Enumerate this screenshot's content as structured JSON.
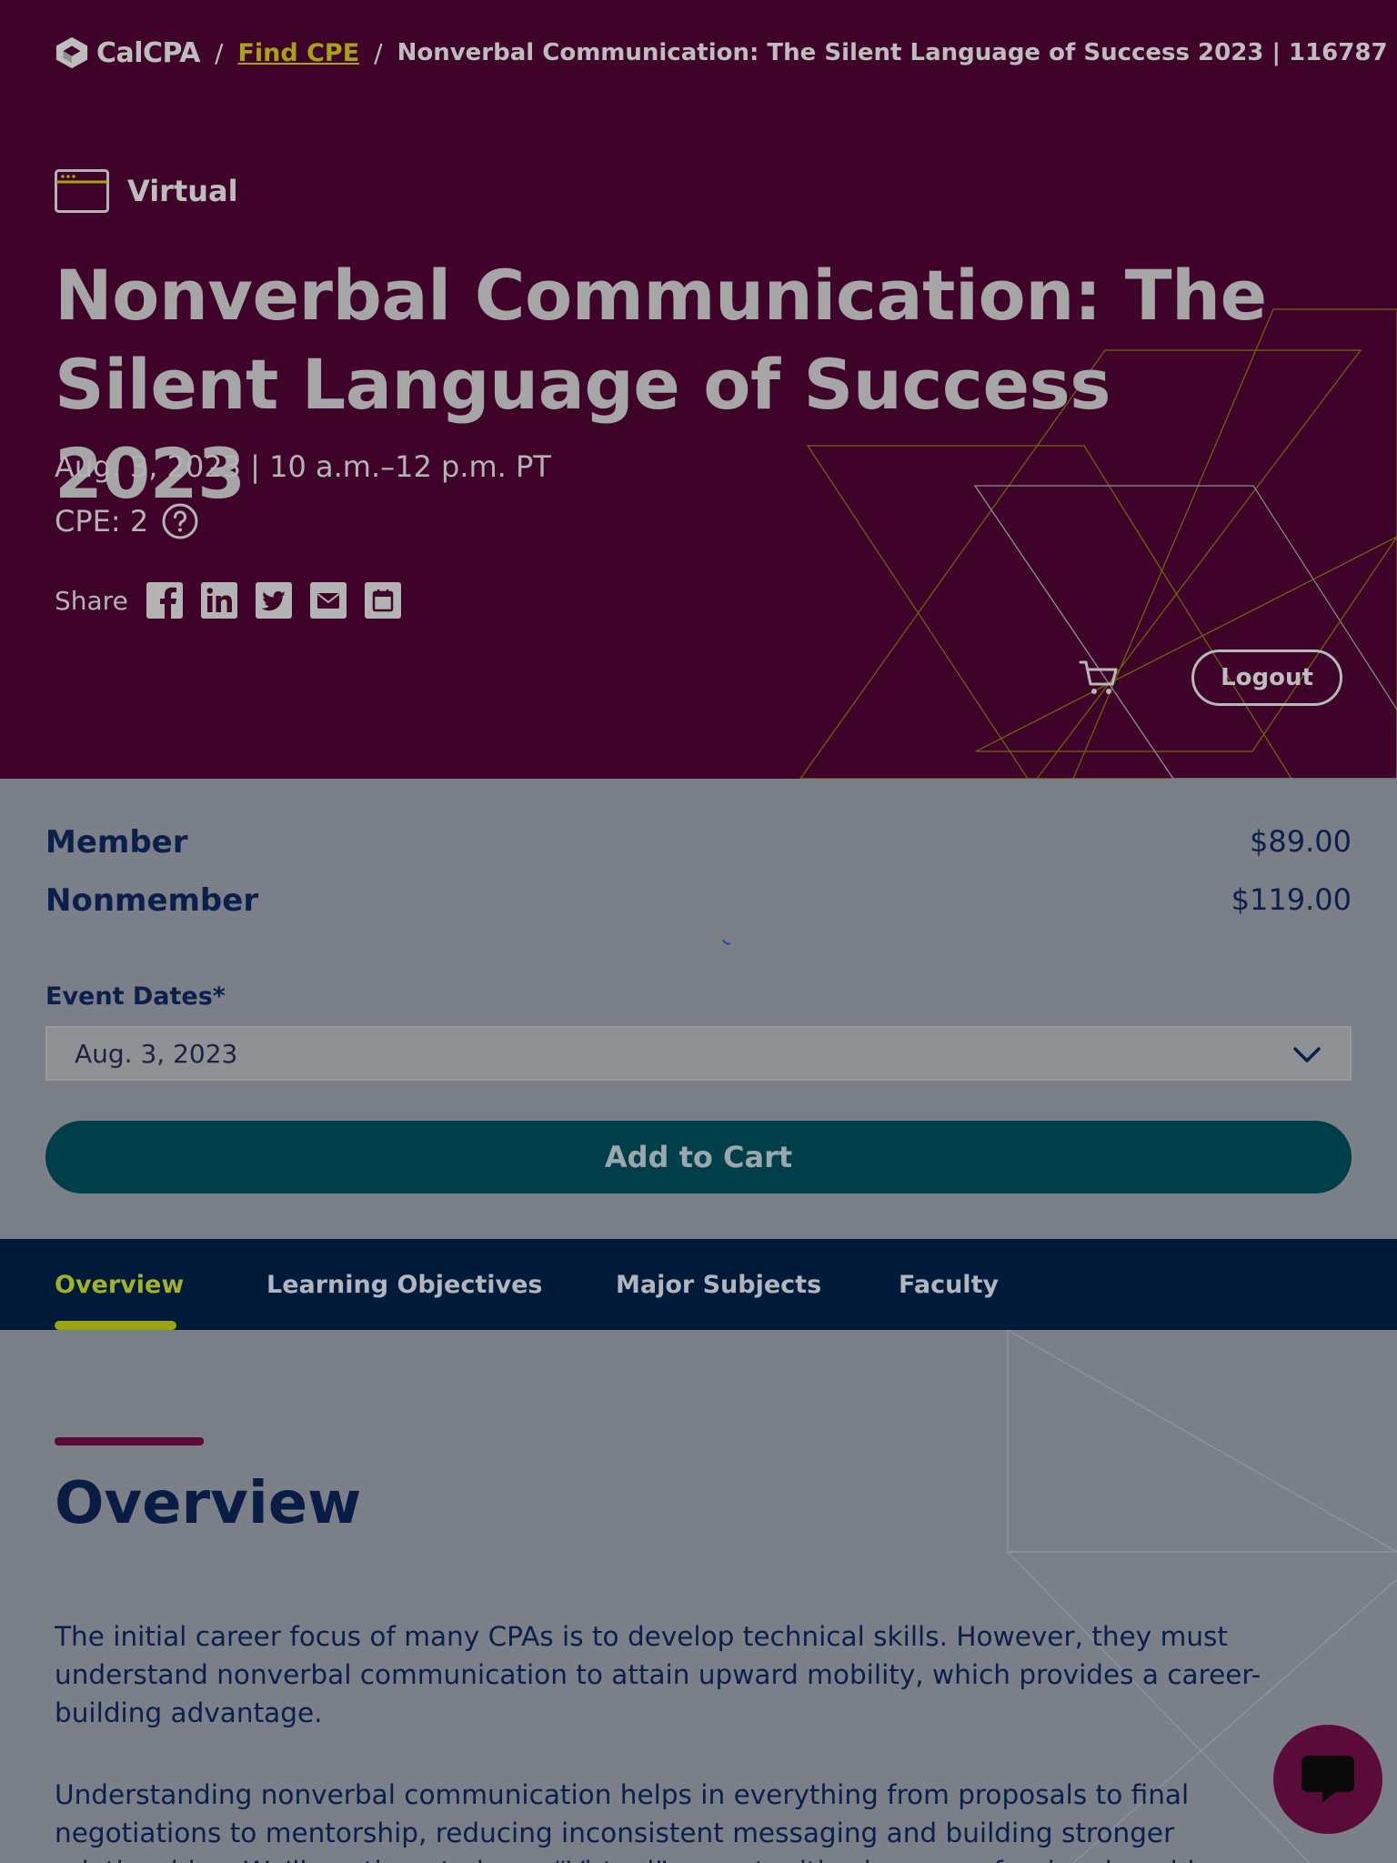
{
  "header": {
    "logo_text": "CalCPA",
    "breadcrumb_sep": "/",
    "breadcrumb_link": "Find CPE",
    "breadcrumb_current": "Nonverbal Communication: The Silent Language of Success 2023 | 116787"
  },
  "event": {
    "format": "Virtual",
    "title_line1": "Nonverbal Communication: The",
    "title_line2": "Silent Language of Success 2023",
    "date_time": "Aug. 3, 2023 | 10 a.m.–12 p.m. PT",
    "cpe": "CPE: 2"
  },
  "share": {
    "label": "Share",
    "icons": [
      "facebook-icon",
      "linkedin-icon",
      "twitter-icon",
      "email-icon",
      "calendar-icon"
    ]
  },
  "account": {
    "cart_icon": "cart-icon",
    "logout_label": "Logout"
  },
  "pricing": {
    "rows": [
      {
        "name": "Member",
        "price": "$89.00"
      },
      {
        "name": "Nonmember",
        "price": "$119.00"
      }
    ]
  },
  "booking": {
    "event_dates_label": "Event Dates*",
    "selected_date": "Aug. 3, 2023",
    "add_to_cart_label": "Add to Cart"
  },
  "tabs": [
    {
      "label": "Overview",
      "active": true
    },
    {
      "label": "Learning Objectives",
      "active": false
    },
    {
      "label": "Major Subjects",
      "active": false
    },
    {
      "label": "Faculty",
      "active": false
    }
  ],
  "overview": {
    "heading": "Overview",
    "para1": "The initial career focus of many CPAs is to develop technical skills. However, they must understand nonverbal communication to attain upward mobility, which provides a career-building advantage.",
    "para2": "Understanding nonverbal communication helps in everything from proposals to final negotiations to mentorship, reducing inconsistent messaging and building stronger relationships. We'll continue to learn “Virtual” opportunities in our professional world."
  },
  "colors": {
    "hero_bg": "#3f032a",
    "accent_yellow": "#a7a414",
    "nav_bg": "#001a3a",
    "cart_button_bg": "#003f4a",
    "heading_navy": "#091d44",
    "chat_bg": "#5b0b3a"
  },
  "chat": {
    "icon": "chat-bubble-icon"
  }
}
